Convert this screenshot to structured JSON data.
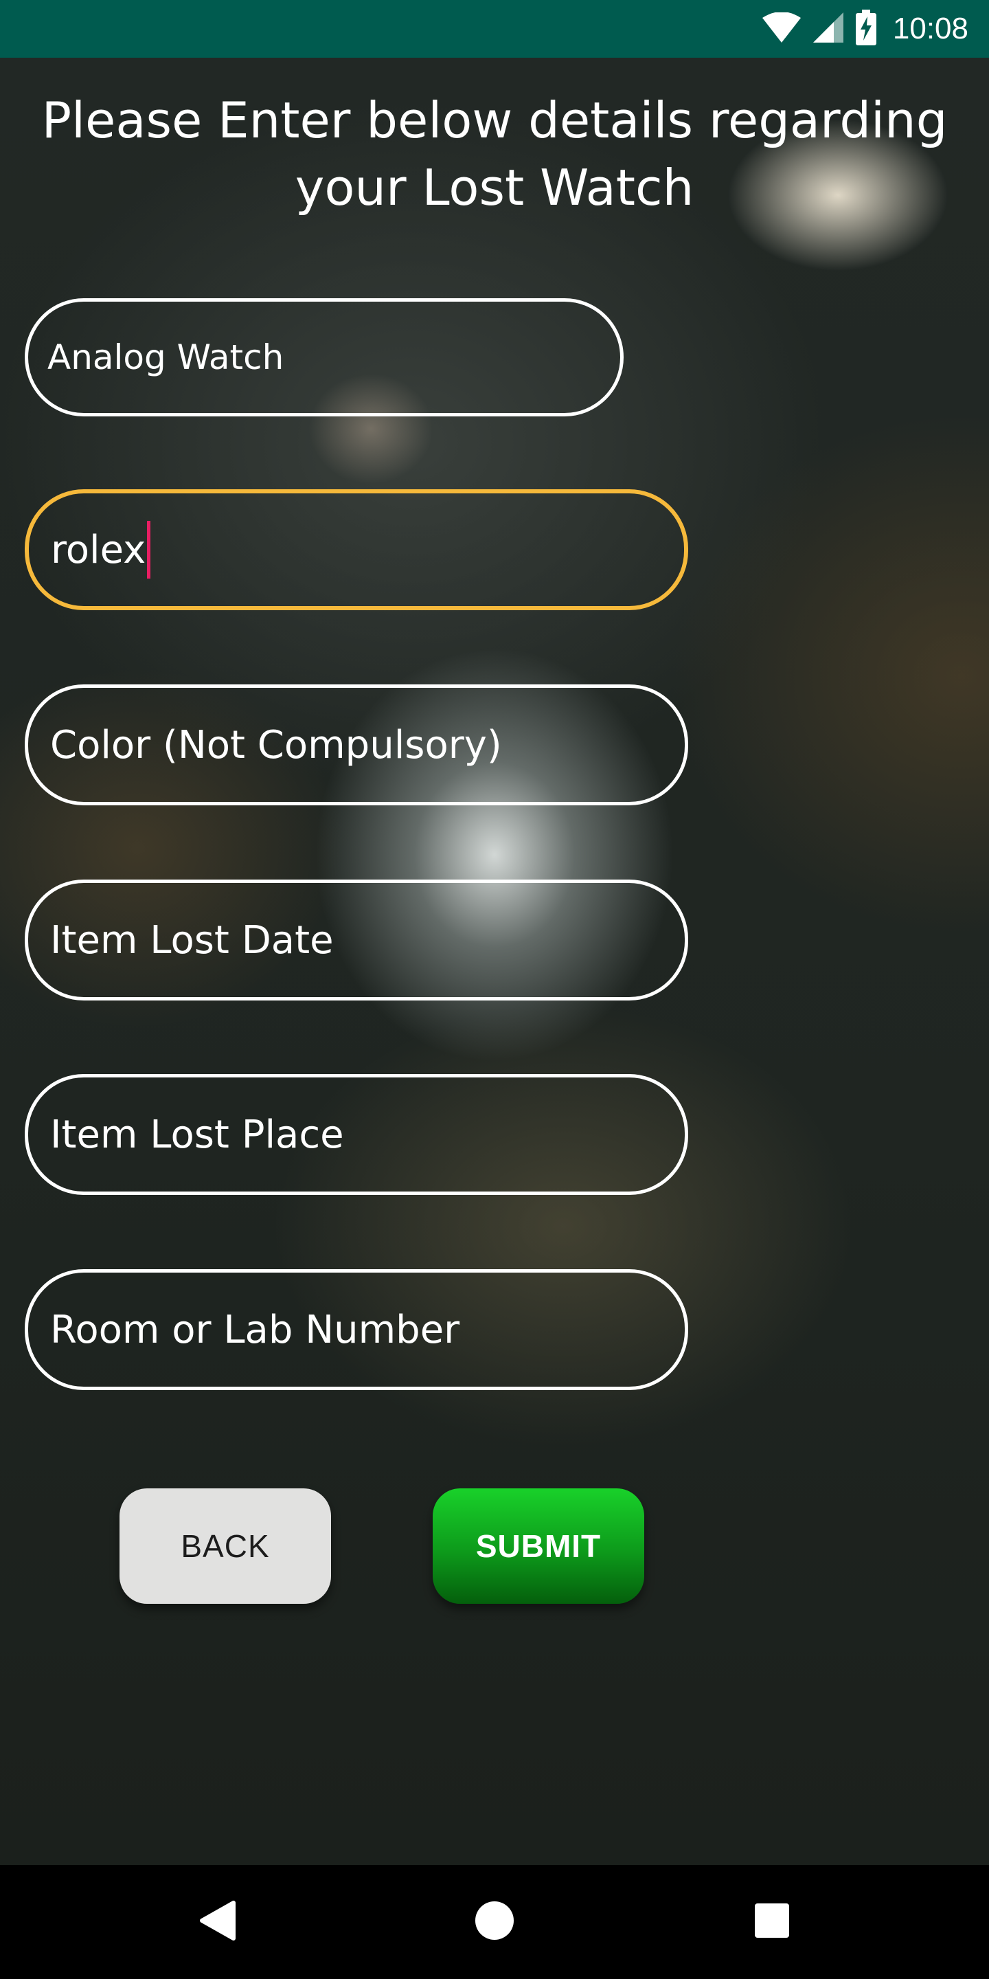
{
  "status_bar": {
    "time": "10:08",
    "icons": [
      "wifi-icon",
      "cell-signal-icon",
      "battery-charging-icon"
    ],
    "background": "#005b4f"
  },
  "page": {
    "heading": "Please Enter below details regarding your Lost Watch"
  },
  "form": {
    "watch_type": {
      "value": "Analog Watch"
    },
    "brand": {
      "value": "rolex",
      "focused": true,
      "focus_color": "#f6b93b"
    },
    "color": {
      "placeholder": "Color (Not Compulsory)"
    },
    "lost_date": {
      "placeholder": "Item Lost Date"
    },
    "lost_place": {
      "placeholder": "Item Lost Place"
    },
    "room": {
      "placeholder": "Room or Lab Number"
    }
  },
  "buttons": {
    "back": "BACK",
    "submit": "SUBMIT",
    "submit_color": "#0d9a1b"
  },
  "nav_bar": {
    "icons": [
      "back-triangle-icon",
      "home-circle-icon",
      "recents-square-icon"
    ]
  }
}
